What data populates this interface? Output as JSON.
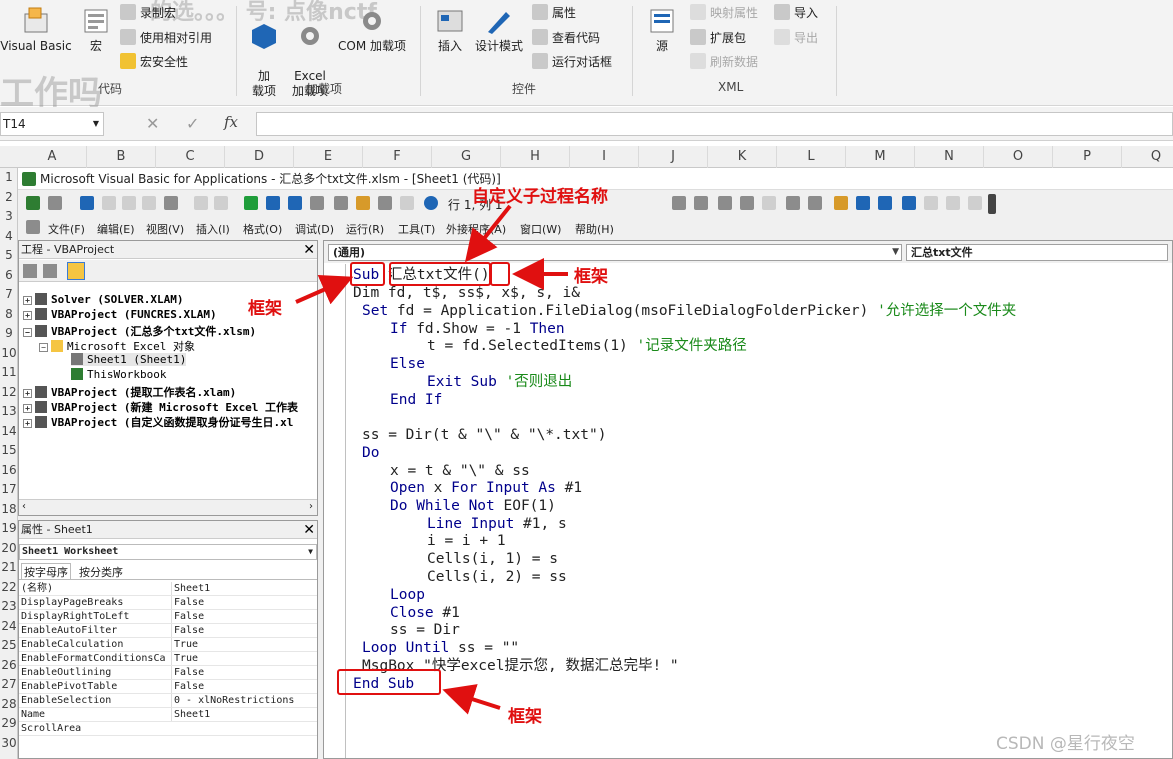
{
  "ribbon": {
    "visual_basic": "Visual Basic",
    "macro": "宏",
    "record_macro": "录制宏",
    "relative_ref": "使用相对引用",
    "macro_security": "宏安全性",
    "group_code": "代码",
    "addins": "加\n载项",
    "excel_addins": "Excel\n加载项",
    "com_addins": "COM 加载项",
    "group_addins": "加载项",
    "insert": "插入",
    "design_mode": "设计模式",
    "properties": "属性",
    "view_code": "查看代码",
    "run_dialog": "运行对话框",
    "group_controls": "控件",
    "source": "源",
    "map_props": "映射属性",
    "expansion_pack": "扩展包",
    "refresh_data": "刷新数据",
    "import": "导入",
    "export": "导出",
    "group_xml": "XML",
    "watermark_left": "工作吗",
    "watermark_top": "的选。。。 号: 点像nctf"
  },
  "formula_bar": {
    "name_box": "T14",
    "cancel": "✕",
    "enter": "✓",
    "fx": "fx"
  },
  "columns": [
    "A",
    "B",
    "C",
    "D",
    "E",
    "F",
    "G",
    "H",
    "I",
    "J",
    "K",
    "L",
    "M",
    "N",
    "O",
    "P",
    "Q"
  ],
  "rows": [
    "1",
    "2",
    "3",
    "4",
    "5",
    "6",
    "7",
    "8",
    "9",
    "10",
    "11",
    "12",
    "13",
    "14",
    "15",
    "16",
    "17",
    "18",
    "19",
    "20",
    "21",
    "22",
    "23",
    "24",
    "25",
    "26",
    "27",
    "28",
    "29",
    "30"
  ],
  "vbe": {
    "title": "Microsoft Visual Basic for Applications - 汇总多个txt文件.xlsm - [Sheet1 (代码)]",
    "position": "行 1, 列 1",
    "menu": [
      "文件(F)",
      "编辑(E)",
      "视图(V)",
      "插入(I)",
      "格式(O)",
      "调试(D)",
      "运行(R)",
      "工具(T)",
      "外接程序(A)",
      "窗口(W)",
      "帮助(H)"
    ],
    "project_title": "工程 - VBAProject",
    "tree": [
      "Solver (SOLVER.XLAM)",
      "VBAProject (FUNCRES.XLAM)",
      "VBAProject (汇总多个txt文件.xlsm)",
      "Microsoft Excel 对象",
      "Sheet1 (Sheet1)",
      "ThisWorkbook",
      "VBAProject (提取工作表名.xlam)",
      "VBAProject (新建 Microsoft Excel 工作表",
      "VBAProject (自定义函数提取身份证号生日.xl"
    ],
    "props_title": "属性 - Sheet1",
    "props_object": "Sheet1 Worksheet",
    "props_tab_alpha": "按字母序",
    "props_tab_cat": "按分类序",
    "props": [
      [
        "(名称)",
        "Sheet1"
      ],
      [
        "DisplayPageBreaks",
        "False"
      ],
      [
        "DisplayRightToLeft",
        "False"
      ],
      [
        "EnableAutoFilter",
        "False"
      ],
      [
        "EnableCalculation",
        "True"
      ],
      [
        "EnableFormatConditionsCa",
        "True"
      ],
      [
        "EnableOutlining",
        "False"
      ],
      [
        "EnablePivotTable",
        "False"
      ],
      [
        "EnableSelection",
        "0 - xlNoRestrictions"
      ],
      [
        "Name",
        "Sheet1"
      ],
      [
        "ScrollArea",
        ""
      ]
    ],
    "combo_object": "(通用)",
    "combo_proc": "汇总txt文件"
  },
  "code": {
    "l1_kw": "Sub",
    "l1_name": " 汇总txt文件",
    "l1_paren": "()",
    "l2": "Dim fd, t$, ss$, x$, s, i&",
    "l3_kw": "Set",
    "l3_rest": " fd = Application.FileDialog(msoFileDialogFolderPicker) ",
    "l3_cm": "'允许选择一个文件夹",
    "l4_kw": "If",
    "l4_rest": " fd.Show = -1 ",
    "l4_kw2": "Then",
    "l5_rest": "t = fd.SelectedItems(1) ",
    "l5_cm": "'记录文件夹路径",
    "l6_kw": "Else",
    "l7_kw": "Exit Sub",
    "l7_cm": " '否则退出",
    "l8_kw": "End If",
    "l9": "ss = Dir(t & \"\\\" & \"\\*.txt\")",
    "l10_kw": "Do",
    "l11": "x = t & \"\\\" & ss",
    "l12_kw": "Open",
    "l12_a": " x ",
    "l12_kw2": "For Input As",
    "l12_b": " #1",
    "l13_kw": "Do While Not",
    "l13_rest": " EOF(1)",
    "l14_kw": "Line Input",
    "l14_rest": " #1, s",
    "l15": "i = i + 1",
    "l16": "Cells(i, 1) = s",
    "l17": "Cells(i, 2) = ss",
    "l18_kw": "Loop",
    "l19_kw": "Close",
    "l19_rest": " #1",
    "l20": "ss = Dir",
    "l21_kw": "Loop Until",
    "l21_rest": " ss = \"\"",
    "l22": "MsgBox \"快学excel提示您, 数据汇总完毕! \"",
    "l23_kw": "End Sub"
  },
  "annotations": {
    "proc_name": "自定义子过程名称",
    "frame1": "框架",
    "frame2": "框架",
    "frame3": "框架"
  },
  "footer": "CSDN @星行夜空"
}
